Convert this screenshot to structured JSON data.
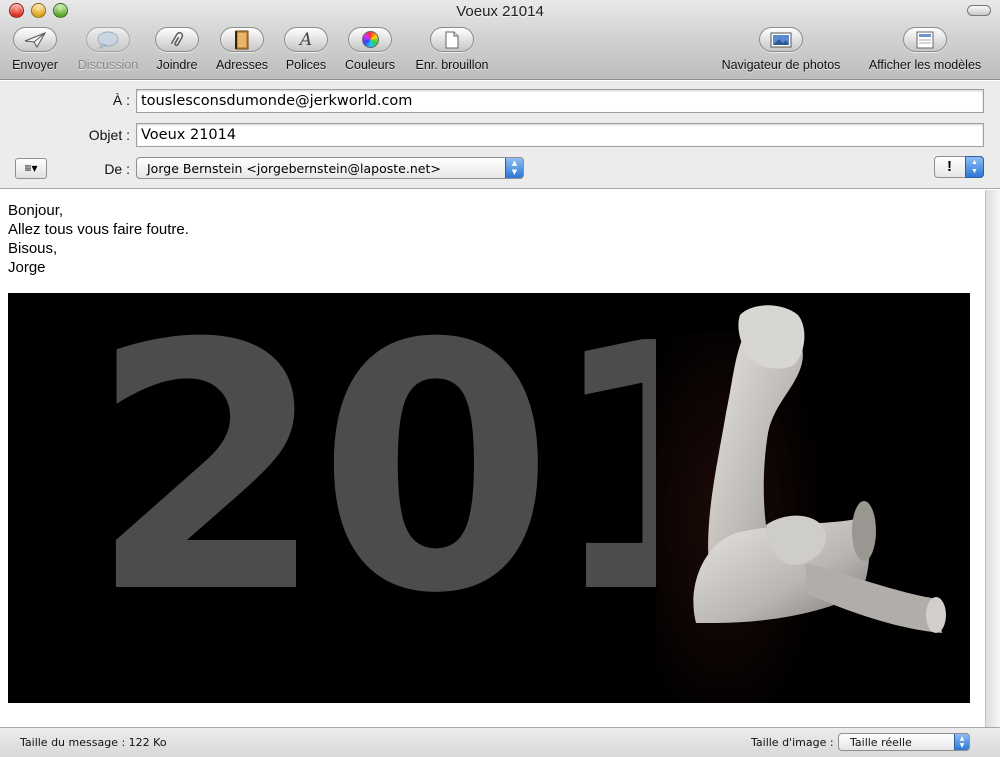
{
  "window": {
    "title": "Voeux 21014"
  },
  "toolbar": {
    "send": "Envoyer",
    "chat": "Discussion",
    "attach": "Joindre",
    "addresses": "Adresses",
    "fonts": "Polices",
    "colors": "Couleurs",
    "save_draft": "Enr. brouillon",
    "photo_browser": "Navigateur de photos",
    "show_stationery": "Afficher les modèles"
  },
  "header": {
    "to_label": "À :",
    "to_value": "touslesconsdumonde@jerkworld.com",
    "subject_label": "Objet :",
    "subject_value": "Voeux 21014",
    "from_label": "De :",
    "from_value": "Jorge Bernstein <jorgebernstein@laposte.net>",
    "priority_symbol": "!"
  },
  "message": {
    "lines": [
      "Bonjour,",
      "Allez tous vous faire foutre.",
      "Bisous,",
      "Jorge"
    ],
    "image_text": "201"
  },
  "status": {
    "message_size": "Taille du message : 122 Ko",
    "image_size_label": "Taille d'image :",
    "image_size_value": "Taille réelle"
  },
  "icons": {
    "send": "paper-plane-icon",
    "chat": "speech-bubble-icon",
    "attach": "paperclip-icon",
    "addresses": "address-book-icon",
    "fonts": "font-icon",
    "colors": "color-wheel-icon",
    "save_draft": "document-icon",
    "photo_browser": "photo-icon",
    "show_stationery": "stationery-icon"
  }
}
